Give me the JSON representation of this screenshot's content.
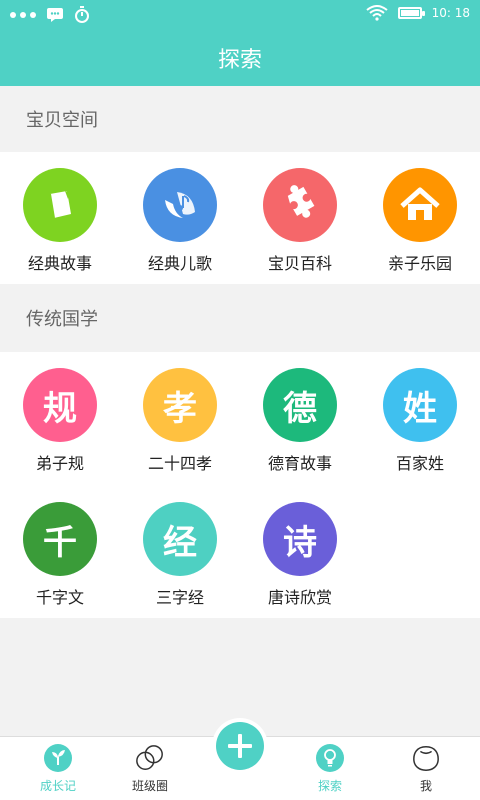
{
  "statusbar": {
    "time": "10: 18"
  },
  "header": {
    "title": "探索"
  },
  "sections": [
    {
      "title": "宝贝空间",
      "items": [
        {
          "label": "经典故事",
          "icon": "book-icon",
          "color": "#7ed321"
        },
        {
          "label": "经典儿歌",
          "icon": "music-icon",
          "color": "#4a90e2"
        },
        {
          "label": "宝贝百科",
          "icon": "puzzle-icon",
          "color": "#f5676a"
        },
        {
          "label": "亲子乐园",
          "icon": "house-icon",
          "color": "#ff9500"
        }
      ]
    },
    {
      "title": "传统国学",
      "items": [
        {
          "label": "弟子规",
          "glyph": "规",
          "color": "#ff5f8f"
        },
        {
          "label": "二十四孝",
          "glyph": "孝",
          "color": "#ffc140"
        },
        {
          "label": "德育故事",
          "glyph": "德",
          "color": "#1db97c"
        },
        {
          "label": "百家姓",
          "glyph": "姓",
          "color": "#3fc0ef"
        },
        {
          "label": "千字文",
          "glyph": "千",
          "color": "#3a9c39"
        },
        {
          "label": "三字经",
          "glyph": "经",
          "color": "#4ed0c2"
        },
        {
          "label": "唐诗欣赏",
          "glyph": "诗",
          "color": "#6a5fd9"
        }
      ]
    }
  ],
  "tabbar": {
    "tabs": [
      {
        "label": "成长记",
        "active": true
      },
      {
        "label": "班级圈",
        "active": false
      },
      {
        "label": "探索",
        "active": true
      },
      {
        "label": "我",
        "active": false
      }
    ]
  },
  "colors": {
    "accent": "#4fd1c5"
  }
}
